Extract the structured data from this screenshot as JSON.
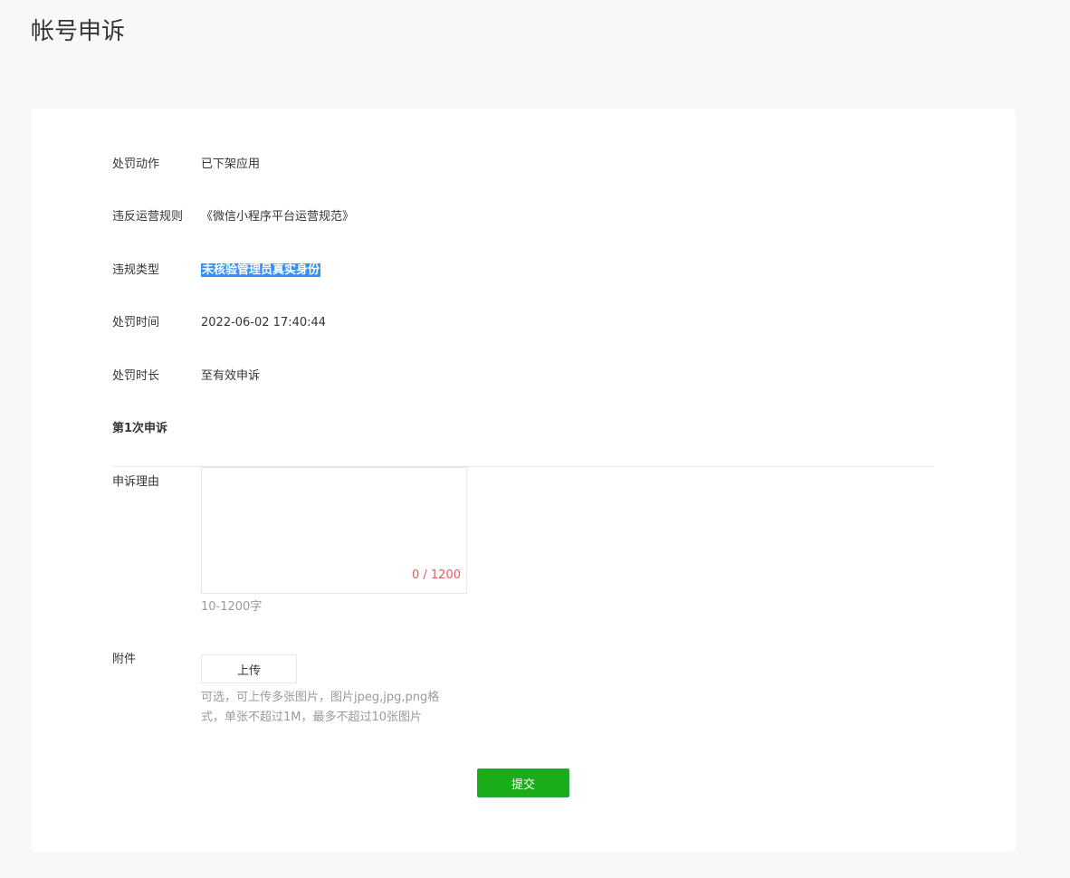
{
  "page": {
    "title": "帐号申诉"
  },
  "details": {
    "punish_action_label": "处罚动作",
    "punish_action_value": "已下架应用",
    "rule_label": "违反运营规则",
    "rule_value": "《微信小程序平台运营规范》",
    "violation_type_label": "违规类型",
    "violation_type_value": "未核验管理员真实身份",
    "punish_time_label": "处罚时间",
    "punish_time_value": "2022-06-02 17:40:44",
    "punish_duration_label": "处罚时长",
    "punish_duration_value": "至有效申诉"
  },
  "appeal": {
    "section_title": "第1次申诉",
    "reason_label": "申诉理由",
    "reason_value": "",
    "reason_counter": "0 / 1200",
    "reason_hint": "10-1200字",
    "attachment_label": "附件",
    "upload_label": "上传",
    "attachment_hint_line1": "可选，可上传多张图片，图片jpeg,jpg,png格",
    "attachment_hint_line2": "式，单张不超过1M，最多不超过10张图片",
    "submit_label": "提交"
  },
  "colors": {
    "background": "#f7f8fa",
    "card": "#ffffff",
    "link": "#576b95",
    "highlight": "#3390ff",
    "counter": "#e15f63",
    "primary_button": "#1aad19"
  }
}
